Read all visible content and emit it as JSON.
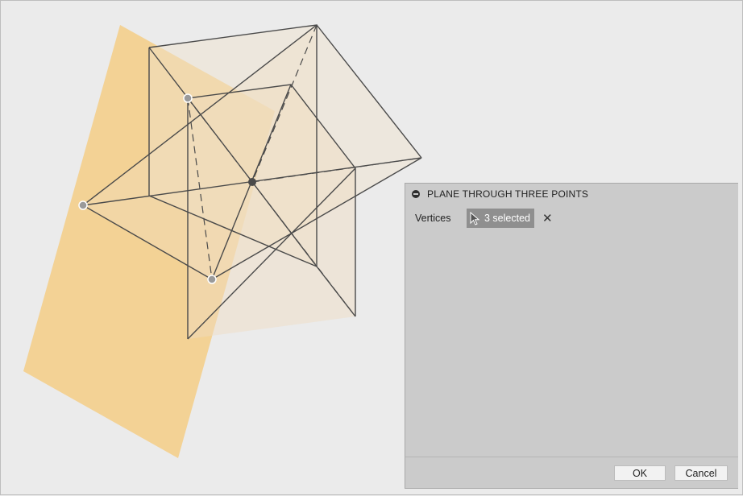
{
  "dialog": {
    "title": "PLANE THROUGH THREE POINTS",
    "vertices_label": "Vertices",
    "selection_count": "3 selected",
    "clear_icon": "close-icon",
    "ok_label": "OK",
    "cancel_label": "Cancel"
  },
  "colors": {
    "construction_plane": "#f5c978",
    "body_faces": "#f0e0c8",
    "edges": "#4a4a4a",
    "dialog_background": "#cbcbcb",
    "selection_button": "#8f8f8f"
  }
}
